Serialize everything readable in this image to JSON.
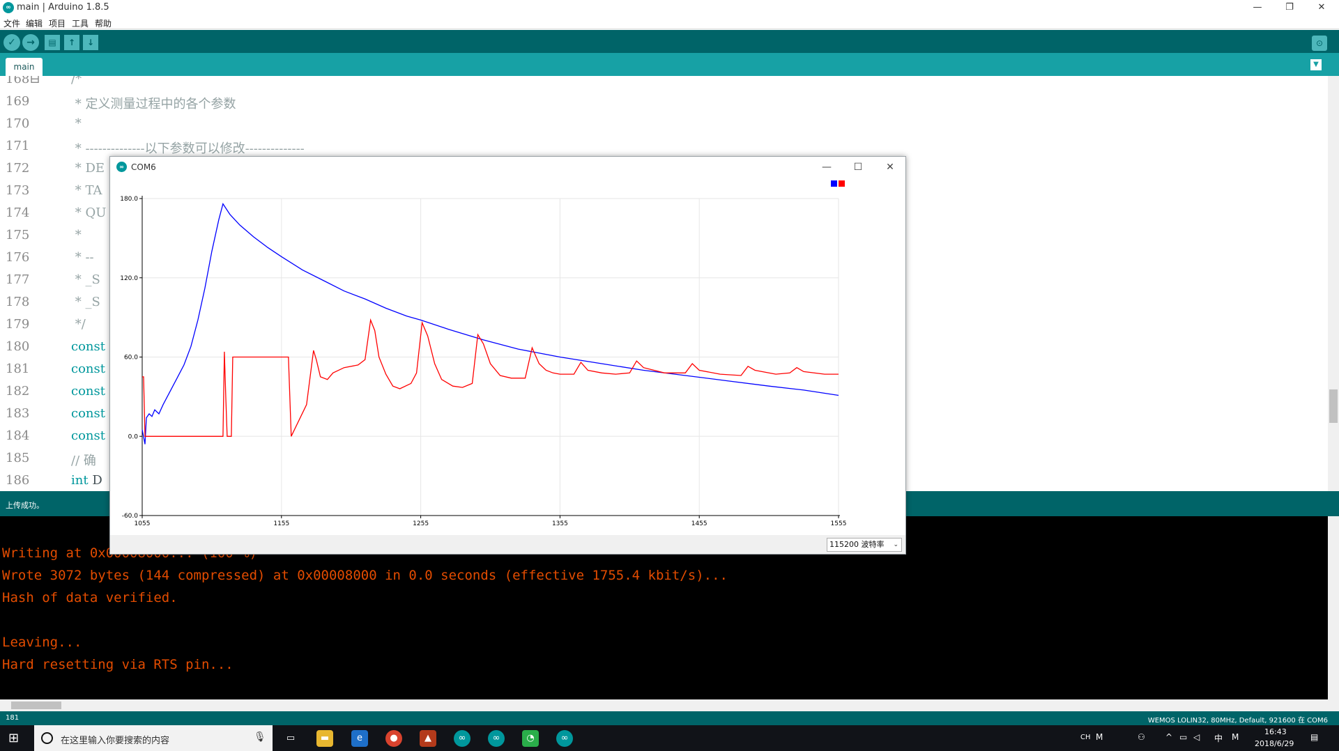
{
  "window": {
    "title": "main | Arduino 1.8.5",
    "icon_label": "∞",
    "minimize": "—",
    "restore": "❐",
    "close": "✕"
  },
  "menu": [
    "文件",
    "编辑",
    "项目",
    "工具",
    "帮助"
  ],
  "toolbar": {
    "verify": "✓",
    "upload": "→",
    "new": "▤",
    "open": "↑",
    "save": "↓",
    "serial_monitor": "⊙"
  },
  "tabs": {
    "main": "main",
    "menu": "▼"
  },
  "editor": {
    "lines": [
      {
        "num": "168⊟",
        "parts": [
          {
            "t": "/*",
            "c": "comment"
          }
        ]
      },
      {
        "num": "169",
        "parts": [
          {
            "t": " * 定义测量过程中的各个参数",
            "c": "comment"
          }
        ]
      },
      {
        "num": "170",
        "parts": [
          {
            "t": " *",
            "c": "comment"
          }
        ]
      },
      {
        "num": "171",
        "parts": [
          {
            "t": " * --------------以下参数可以修改--------------",
            "c": "comment"
          }
        ]
      },
      {
        "num": "172",
        "parts": [
          {
            "t": " * DE",
            "c": "comment"
          }
        ]
      },
      {
        "num": "173",
        "parts": [
          {
            "t": " * TA",
            "c": "comment"
          }
        ]
      },
      {
        "num": "174",
        "parts": [
          {
            "t": " * QU",
            "c": "comment"
          }
        ]
      },
      {
        "num": "175",
        "parts": [
          {
            "t": " *",
            "c": "comment"
          }
        ]
      },
      {
        "num": "176",
        "parts": [
          {
            "t": " * --",
            "c": "comment"
          }
        ]
      },
      {
        "num": "177",
        "parts": [
          {
            "t": " * _S",
            "c": "comment"
          }
        ]
      },
      {
        "num": "178",
        "parts": [
          {
            "t": " * _S",
            "c": "comment"
          }
        ]
      },
      {
        "num": "179",
        "parts": [
          {
            "t": " */",
            "c": "comment"
          }
        ]
      },
      {
        "num": "180",
        "parts": [
          {
            "t": "const",
            "c": "kw"
          }
        ]
      },
      {
        "num": "181",
        "parts": [
          {
            "t": "const",
            "c": "kw"
          }
        ]
      },
      {
        "num": "182",
        "parts": [
          {
            "t": "const",
            "c": "kw"
          }
        ]
      },
      {
        "num": "183",
        "parts": [
          {
            "t": "const",
            "c": "kw"
          }
        ]
      },
      {
        "num": "184",
        "parts": [
          {
            "t": "const",
            "c": "kw"
          }
        ]
      },
      {
        "num": "185",
        "parts": [
          {
            "t": "// 确",
            "c": "comment"
          }
        ]
      },
      {
        "num": "186",
        "parts": [
          {
            "t": "int",
            "c": "kw"
          },
          {
            "t": " D",
            "c": "plain"
          }
        ]
      }
    ]
  },
  "status": {
    "message": "上传成功。"
  },
  "console": {
    "lines": [
      "Writing at 0x00008000... (100 %)",
      "Wrote 3072 bytes (144 compressed) at 0x00008000 in 0.0 seconds (effective 1755.4 kbit/s)...",
      "Hash of data verified.",
      "",
      "Leaving...",
      "Hard resetting via RTS pin..."
    ]
  },
  "bottom_status": {
    "line_number": "181",
    "board": "WEMOS LOLIN32, 80MHz, Default, 921600 在 COM6"
  },
  "plotter": {
    "title": "COM6",
    "minimize": "—",
    "maximize": "☐",
    "close": "✕",
    "baud": "115200 波特率",
    "baud_arrow": "⌄",
    "colors": {
      "series1": "#0000ff",
      "series2": "#ff0000"
    }
  },
  "chart_data": {
    "type": "line",
    "title": "",
    "xlabel": "",
    "ylabel": "",
    "xlim": [
      1055,
      1555
    ],
    "ylim": [
      -60,
      180
    ],
    "x_ticks": [
      "1055",
      "1155",
      "1255",
      "1355",
      "1455",
      "1555"
    ],
    "y_ticks": [
      "180.0",
      "120.0",
      "60.0",
      "0.0",
      "-60.0"
    ],
    "grid": true,
    "legend": "top-right",
    "series": [
      {
        "color": "#0000ff",
        "points": [
          [
            1055,
            5
          ],
          [
            1057,
            -6
          ],
          [
            1058,
            14
          ],
          [
            1060,
            17
          ],
          [
            1062,
            15
          ],
          [
            1064,
            20
          ],
          [
            1067,
            17
          ],
          [
            1070,
            24
          ],
          [
            1075,
            34
          ],
          [
            1080,
            44
          ],
          [
            1085,
            54
          ],
          [
            1090,
            68
          ],
          [
            1095,
            88
          ],
          [
            1100,
            112
          ],
          [
            1105,
            140
          ],
          [
            1110,
            164
          ],
          [
            1113,
            176
          ],
          [
            1118,
            168
          ],
          [
            1125,
            160
          ],
          [
            1135,
            151
          ],
          [
            1145,
            143
          ],
          [
            1155,
            136
          ],
          [
            1170,
            126
          ],
          [
            1185,
            118
          ],
          [
            1200,
            110
          ],
          [
            1215,
            104
          ],
          [
            1230,
            97
          ],
          [
            1245,
            91
          ],
          [
            1255,
            88
          ],
          [
            1275,
            81
          ],
          [
            1300,
            73
          ],
          [
            1325,
            66
          ],
          [
            1355,
            60
          ],
          [
            1385,
            55
          ],
          [
            1415,
            50
          ],
          [
            1445,
            46
          ],
          [
            1475,
            42
          ],
          [
            1505,
            38
          ],
          [
            1530,
            35
          ],
          [
            1555,
            31
          ]
        ]
      },
      {
        "color": "#ff0000",
        "points": [
          [
            1055,
            45
          ],
          [
            1056,
            45
          ],
          [
            1057,
            0
          ],
          [
            1113,
            0
          ],
          [
            1114,
            64
          ],
          [
            1115,
            30
          ],
          [
            1116,
            0
          ],
          [
            1119,
            0
          ],
          [
            1120,
            60
          ],
          [
            1160,
            60
          ],
          [
            1162,
            0
          ],
          [
            1173,
            24
          ],
          [
            1178,
            65
          ],
          [
            1180,
            58
          ],
          [
            1183,
            45
          ],
          [
            1188,
            43
          ],
          [
            1192,
            48
          ],
          [
            1200,
            52
          ],
          [
            1210,
            54
          ],
          [
            1215,
            58
          ],
          [
            1219,
            88
          ],
          [
            1222,
            80
          ],
          [
            1225,
            60
          ],
          [
            1230,
            47
          ],
          [
            1235,
            38
          ],
          [
            1240,
            36
          ],
          [
            1248,
            40
          ],
          [
            1252,
            48
          ],
          [
            1256,
            86
          ],
          [
            1260,
            76
          ],
          [
            1265,
            55
          ],
          [
            1270,
            43
          ],
          [
            1278,
            38
          ],
          [
            1285,
            37
          ],
          [
            1292,
            40
          ],
          [
            1296,
            77
          ],
          [
            1300,
            70
          ],
          [
            1305,
            55
          ],
          [
            1312,
            46
          ],
          [
            1320,
            44
          ],
          [
            1330,
            44
          ],
          [
            1335,
            67
          ],
          [
            1340,
            55
          ],
          [
            1345,
            50
          ],
          [
            1350,
            48
          ],
          [
            1355,
            47
          ],
          [
            1365,
            47
          ],
          [
            1370,
            56
          ],
          [
            1375,
            50
          ],
          [
            1385,
            48
          ],
          [
            1395,
            47
          ],
          [
            1405,
            48
          ],
          [
            1410,
            57
          ],
          [
            1415,
            52
          ],
          [
            1430,
            48
          ],
          [
            1445,
            48
          ],
          [
            1450,
            55
          ],
          [
            1455,
            50
          ],
          [
            1470,
            47
          ],
          [
            1485,
            46
          ],
          [
            1490,
            53
          ],
          [
            1495,
            50
          ],
          [
            1510,
            47
          ],
          [
            1520,
            48
          ],
          [
            1525,
            52
          ],
          [
            1530,
            49
          ],
          [
            1545,
            47
          ],
          [
            1555,
            47
          ]
        ]
      }
    ]
  }
}
